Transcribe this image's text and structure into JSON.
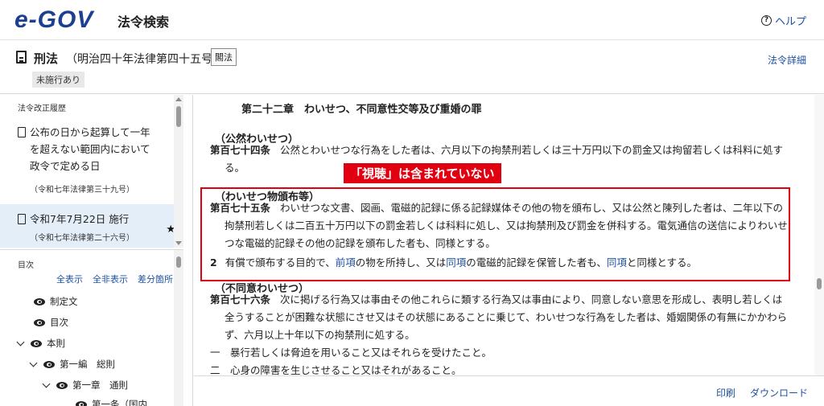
{
  "header": {
    "logo": "e-GOV",
    "app_title": "法令検索",
    "help_label": "ヘルプ"
  },
  "law": {
    "name": "刑法",
    "number": "（明治四十年法律第四十五号）",
    "close_button": "閣法",
    "status_badge": "未施行あり",
    "detail_link": "法令詳細"
  },
  "history": {
    "title": "法令改正履歴",
    "items": [
      {
        "line1": "公布の日から起算して一年",
        "line2": "を超えない範囲内において",
        "line3": "政令で定める日",
        "sub": "（令和七年法律第三十九号）"
      },
      {
        "line1": "令和7年7月22日 施行",
        "sub": "（令和七年法律第二十六号）"
      }
    ]
  },
  "toc": {
    "title": "目次",
    "links": [
      "全表示",
      "全非表示",
      "差分箇所"
    ],
    "items": [
      "制定文",
      "目次",
      "本則",
      "第一編　総則",
      "第一章　通則",
      "第一条（国内"
    ]
  },
  "content": {
    "chapter": "第二十二章　わいせつ、不同意性交等及び重婚の罪",
    "caption174": "（公然わいせつ）",
    "art174_num": "第百七十四条",
    "art174_text": "公然とわいせつな行為をした者は、六月以下の拘禁刑若しくは三十万円以下の罰金又は拘留若しくは科料に処する。",
    "annotation": "「視聴」は含まれていない",
    "caption175": "（わいせつ物頒布等）",
    "art175_num": "第百七十五条",
    "art175_text": "わいせつな文書、図画、電磁的記録に係る記録媒体その他の物を頒布し、又は公然と陳列した者は、二年以下の拘禁刑若しくは二百五十万円以下の罰金若しくは科料に処し、又は拘禁刑及び罰金を併科する。電気通信の送信によりわいせつな電磁的記録その他の記録を頒布した者も、同様とする。",
    "art175_p2_num": "2",
    "art175_p2_a": "有償で頒布する目的で、",
    "art175_p2_link1": "前項",
    "art175_p2_b": "の物を所持し、又は",
    "art175_p2_link2": "同項",
    "art175_p2_c": "の電磁的記録を保管した者も、",
    "art175_p2_link3": "同項",
    "art175_p2_d": "と同様とする。",
    "caption176": "（不同意わいせつ）",
    "art176_num": "第百七十六条",
    "art176_text": "次に掲げる行為又は事由その他これらに類する行為又は事由により、同意しない意思を形成し、表明し若しくは全うすることが困難な状態にさせ又はその状態にあることに乗じて、わいせつな行為をした者は、婚姻関係の有無にかかわらず、六月以上十年以下の拘禁刑に処する。",
    "art176_i1": "一　暴行若しくは脅迫を用いること又はそれらを受けたこと。",
    "art176_i2": "二　心身の障害を生じさせること又はそれがあること。"
  },
  "footer": {
    "print": "印刷",
    "download": "ダウンロード"
  },
  "colors": {
    "brand": "#1d3f91",
    "link": "#1d50a2",
    "highlight": "#e00010"
  }
}
